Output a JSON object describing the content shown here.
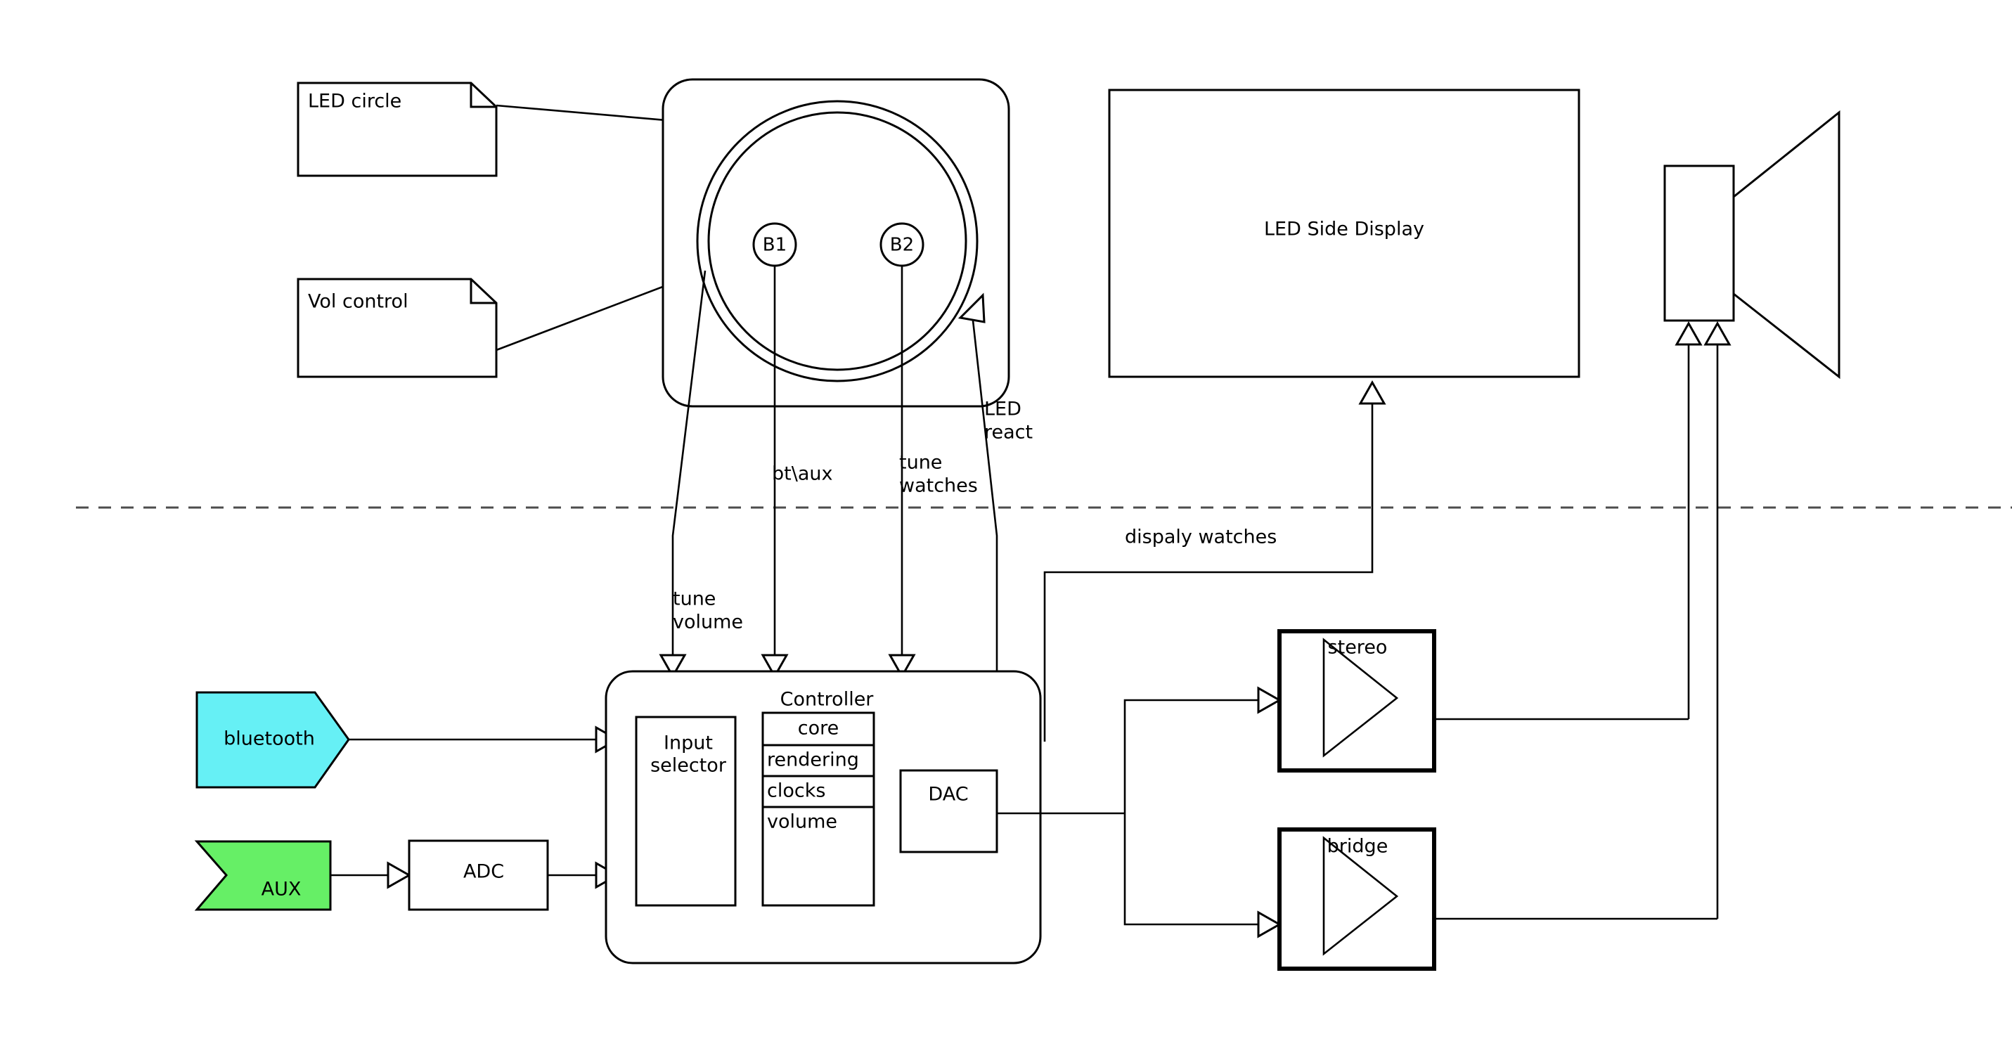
{
  "diagram": {
    "title": "Speaker System Block Diagram",
    "divider_label": "",
    "colors": {
      "bluetooth_fill": "#66f0f5",
      "aux_fill": "#66ef66",
      "stroke": "#000000",
      "divider": "#4d4d4d",
      "background": "#ffffff"
    }
  },
  "notes": [
    {
      "id": "led-circle",
      "text": "LED circle"
    },
    {
      "id": "vol-control",
      "text": "Vol control"
    }
  ],
  "panel": {
    "buttons": [
      {
        "id": "b1",
        "label": "B1"
      },
      {
        "id": "b2",
        "label": "B2"
      }
    ]
  },
  "display": {
    "label": "LED Side Display"
  },
  "speaker": {
    "label": ""
  },
  "inputs": [
    {
      "id": "bluetooth",
      "label": "bluetooth",
      "shape": "arrow-pentagon",
      "fill": "#66f0f5"
    },
    {
      "id": "aux",
      "label": "AUX",
      "shape": "chevron",
      "fill": "#66ef66"
    }
  ],
  "adc": {
    "label": "ADC"
  },
  "controller": {
    "label": "Controller",
    "input_selector": {
      "label": "Input\nselector",
      "line1": "Input",
      "line2": "selector"
    },
    "stack": [
      {
        "label": "core",
        "align": "center"
      },
      {
        "label": "rendering",
        "align": "left"
      },
      {
        "label": "clocks",
        "align": "left"
      },
      {
        "label": "volume",
        "align": "left"
      }
    ],
    "dac": {
      "label": "DAC"
    }
  },
  "amplifiers": [
    {
      "id": "stereo",
      "label": "stereo"
    },
    {
      "id": "bridge",
      "label": "bridge"
    }
  ],
  "signal_labels": [
    {
      "id": "tune-volume",
      "line1": "tune",
      "line2": "volume"
    },
    {
      "id": "bt-aux",
      "line1": "bt\\aux",
      "line2": ""
    },
    {
      "id": "tune-watches",
      "line1": "tune",
      "line2": "watches"
    },
    {
      "id": "led-react",
      "line1": "LED",
      "line2": "react"
    },
    {
      "id": "display-watches",
      "line1": "dispaly watches",
      "line2": ""
    }
  ]
}
